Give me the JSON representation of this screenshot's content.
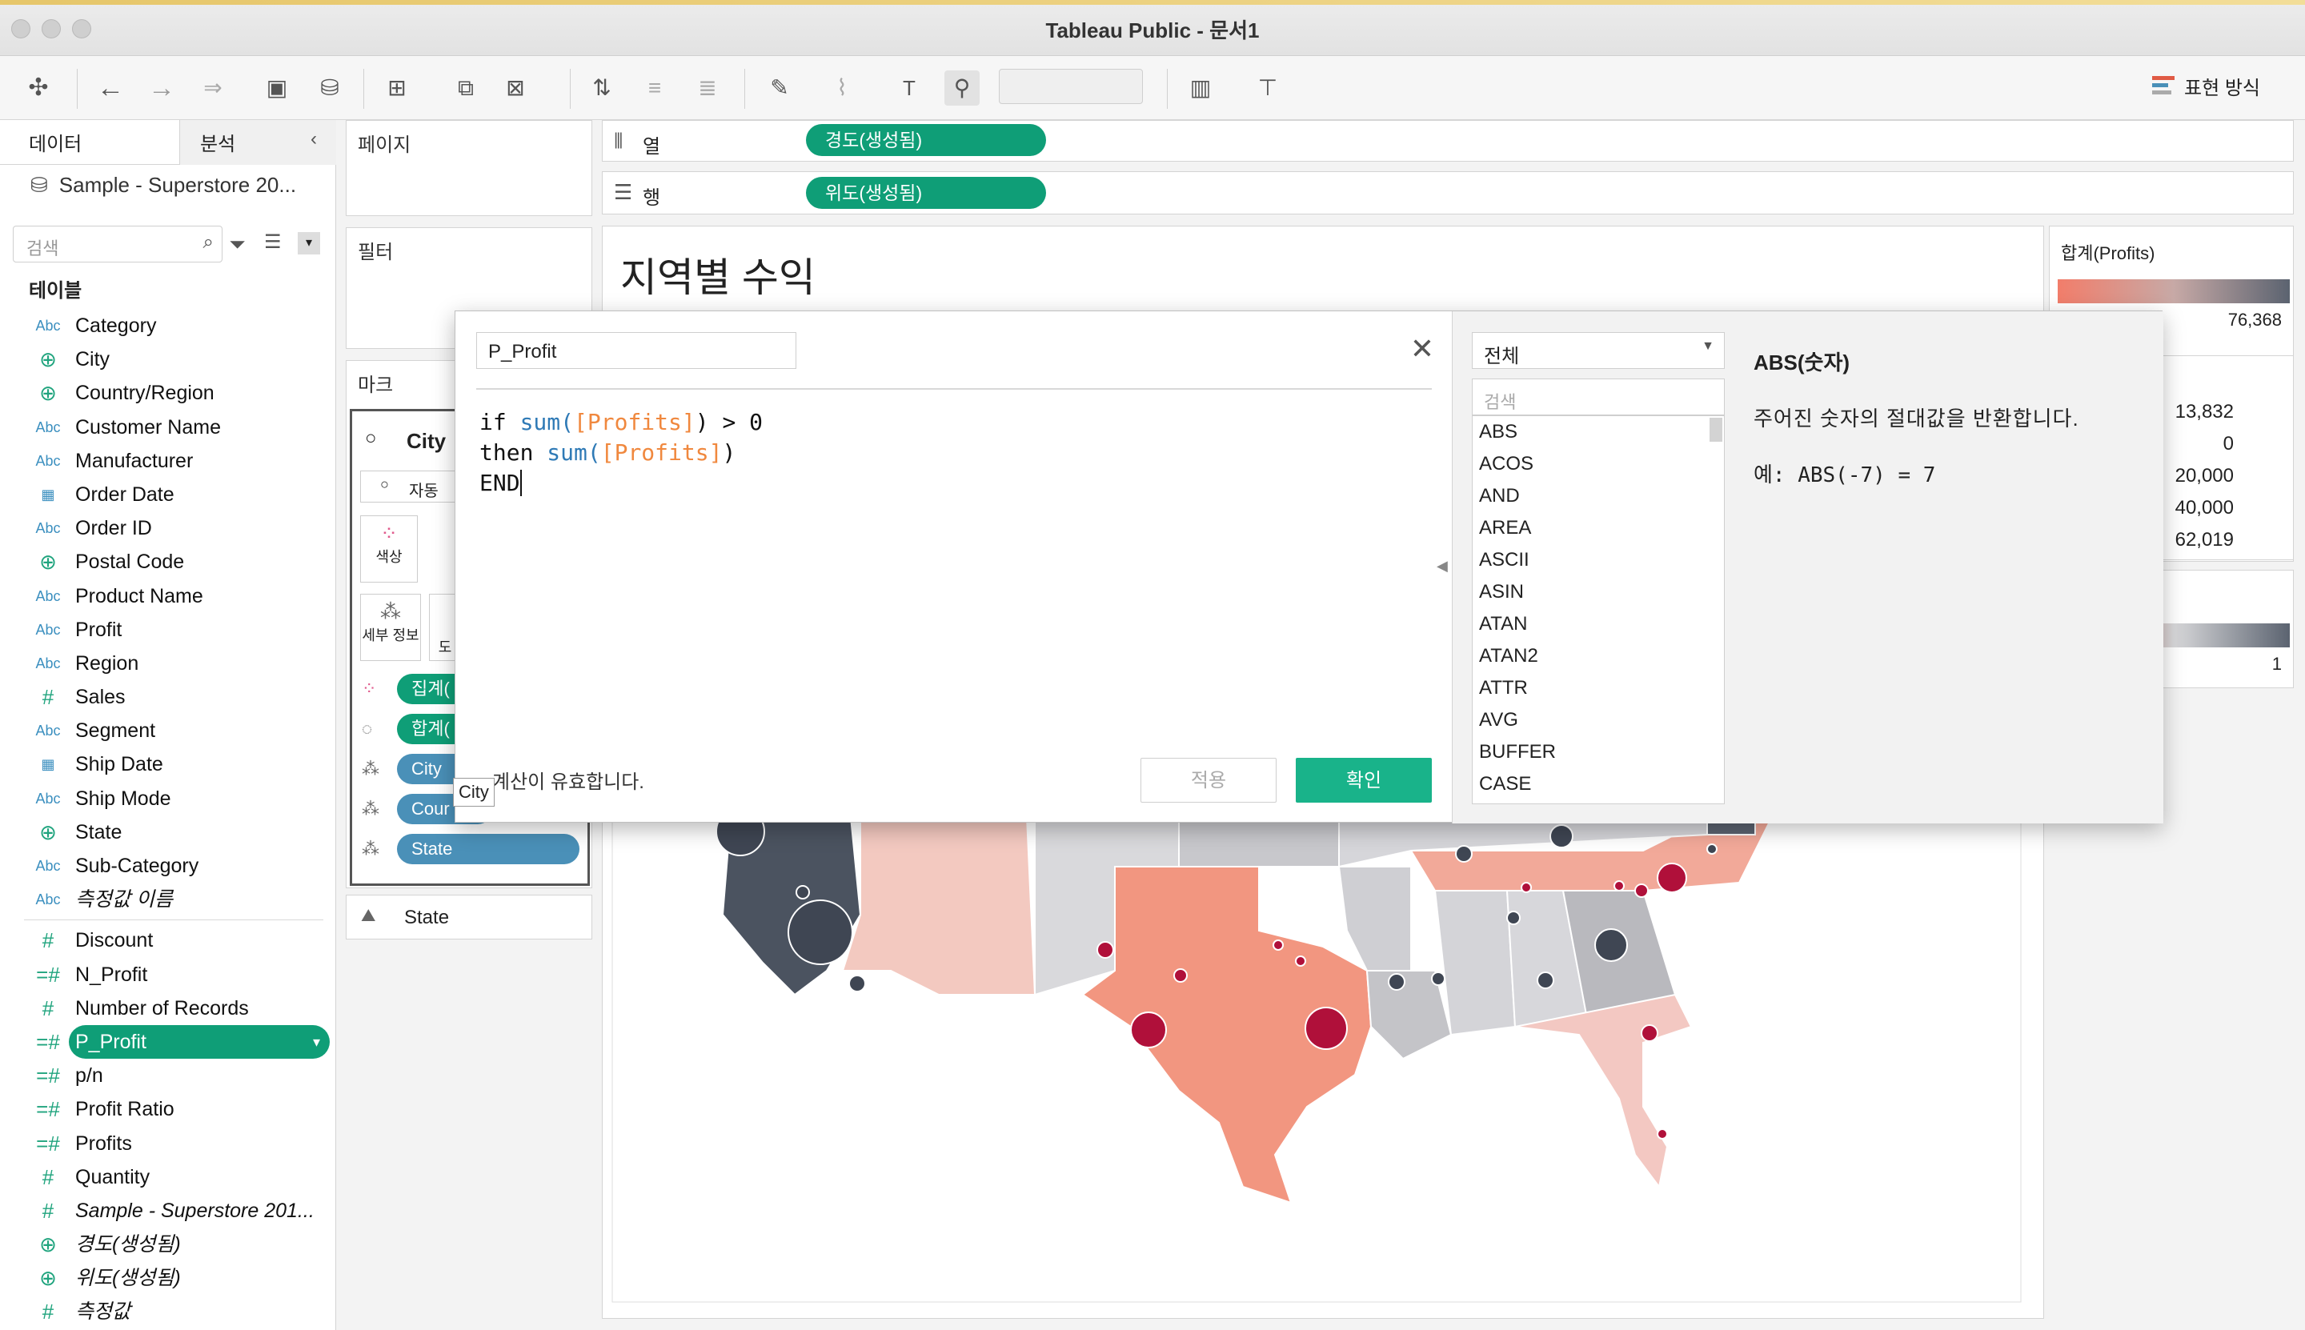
{
  "window": {
    "title": "Tableau Public - 문서1"
  },
  "toolbar": {
    "show_me": "표현 방식"
  },
  "data_pane": {
    "tab_data": "데이터",
    "tab_analysis": "분석",
    "datasource": "Sample - Superstore 20...",
    "search_placeholder": "검색",
    "tables_header": "테이블",
    "dims": [
      {
        "label": "Category",
        "type": "Abc"
      },
      {
        "label": "City",
        "type": "geo"
      },
      {
        "label": "Country/Region",
        "type": "geo"
      },
      {
        "label": "Customer Name",
        "type": "Abc"
      },
      {
        "label": "Manufacturer",
        "type": "Abc"
      },
      {
        "label": "Order Date",
        "type": "date"
      },
      {
        "label": "Order ID",
        "type": "Abc"
      },
      {
        "label": "Postal Code",
        "type": "geo"
      },
      {
        "label": "Product Name",
        "type": "Abc"
      },
      {
        "label": "Profit",
        "type": "Abc"
      },
      {
        "label": "Region",
        "type": "Abc"
      },
      {
        "label": "Sales",
        "type": "#"
      },
      {
        "label": "Segment",
        "type": "Abc"
      },
      {
        "label": "Ship Date",
        "type": "date"
      },
      {
        "label": "Ship Mode",
        "type": "Abc"
      },
      {
        "label": "State",
        "type": "geo"
      },
      {
        "label": "Sub-Category",
        "type": "Abc"
      },
      {
        "label": "측정값 이름",
        "type": "Abc",
        "italic": true
      }
    ],
    "measures": [
      {
        "label": "Discount",
        "type": "#"
      },
      {
        "label": "N_Profit",
        "type": "=#"
      },
      {
        "label": "Number of Records",
        "type": "#"
      },
      {
        "label": "P_Profit",
        "type": "=#",
        "selected": true
      },
      {
        "label": "p/n",
        "type": "=#"
      },
      {
        "label": "Profit Ratio",
        "type": "=#"
      },
      {
        "label": "Profits",
        "type": "=#"
      },
      {
        "label": "Quantity",
        "type": "#"
      },
      {
        "label": "Sample - Superstore 201...",
        "type": "#",
        "italic": true
      },
      {
        "label": "경도(생성됨)",
        "type": "geo",
        "italic": true
      },
      {
        "label": "위도(생성됨)",
        "type": "geo",
        "italic": true
      },
      {
        "label": "측정값",
        "type": "#",
        "italic": true
      }
    ]
  },
  "cards": {
    "pages": "페이지",
    "filters": "필터",
    "marks": "마크",
    "marks_type": "City",
    "marks_auto": "자동",
    "color": "색상",
    "detail": "세부 정보",
    "detail2": "도",
    "mark_pills": [
      "집계(",
      "합계(",
      "City",
      "Cour",
      "State"
    ],
    "state_card": "State"
  },
  "shelves": {
    "columns_label": "열",
    "columns_pill": "경도(생성됨)",
    "rows_label": "행",
    "rows_pill": "위도(생성됨)"
  },
  "view": {
    "title": "지역별 수익"
  },
  "legend": {
    "title": "합계(Profits)",
    "max": "76,368",
    "values": [
      "13,832",
      "0",
      "20,000",
      "40,000",
      "62,019"
    ],
    "small_max": "1"
  },
  "dialog": {
    "name": "P_Profit",
    "code_line1_kw": "if ",
    "code_line1_fn": "sum(",
    "code_line1_fld": "[Profits]",
    "code_line1_end": ") > 0",
    "code_line2_kw": "then ",
    "code_line2_fn": "sum(",
    "code_line2_fld": "[Profits]",
    "code_line2_end": ")",
    "code_line3": "END",
    "status": "계산이 유효합니다.",
    "tooltip": "City",
    "apply": "적용",
    "ok": "확인",
    "func_category": "전체",
    "func_search": "검색",
    "functions": [
      "ABS",
      "ACOS",
      "AND",
      "AREA",
      "ASCII",
      "ASIN",
      "ATAN",
      "ATAN2",
      "ATTR",
      "AVG",
      "BUFFER",
      "CASE"
    ],
    "help_title": "ABS(숫자)",
    "help_desc": "주어진 숫자의 절대값을 반환합니다.",
    "help_example": "예: ABS(-7) = 7"
  },
  "colors": {
    "accent": "#0f9e77",
    "pill_blue": "#4a90b8",
    "profit_high": "#b0103a",
    "profit_low": "#f6b8a8",
    "loss": "#4b5360"
  }
}
